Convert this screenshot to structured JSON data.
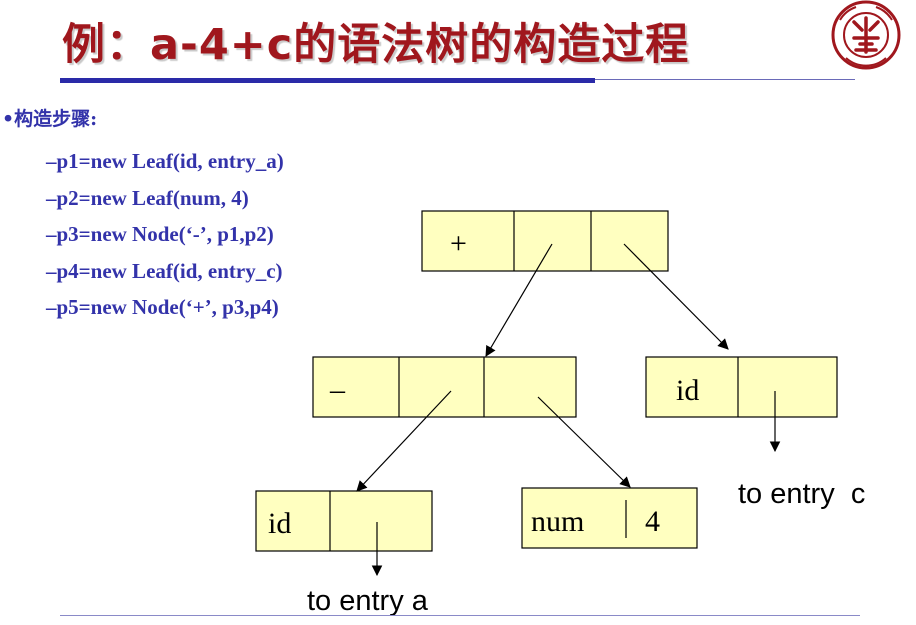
{
  "slide": {
    "title": "例：a-4+c的语法树的构造过程",
    "bullet": "•构造步骤:",
    "steps": [
      "–p1=new Leaf(id, entry_a)",
      "–p2=new Leaf(num, 4)",
      "–p3=new Node(‘-’, p1,p2)",
      "–p4=new Leaf(id, entry_c)",
      "–p5=new Node(‘+’, p3,p4)"
    ]
  },
  "tree": {
    "plus_node": {
      "op": "+"
    },
    "minus_node": {
      "op": "–"
    },
    "leaf_c": {
      "label": "id",
      "caption": "to entry  c"
    },
    "leaf_a": {
      "label": "id",
      "caption": "to entry a"
    },
    "leaf_num": {
      "label": "num",
      "value": "4"
    }
  },
  "colors": {
    "title": "#a0171d",
    "text": "#3333aa",
    "cell_fill": "#ffffc0",
    "rule": "#2a2aa8"
  }
}
